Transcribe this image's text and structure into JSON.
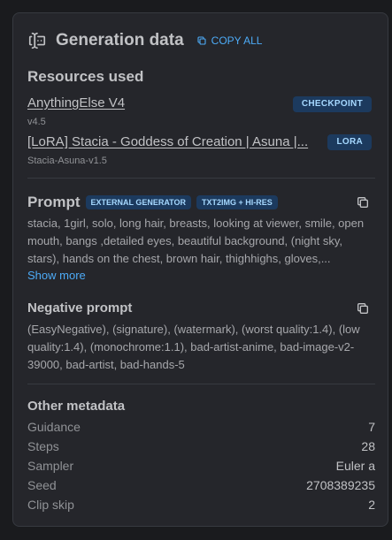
{
  "header": {
    "title": "Generation data",
    "copy_all_label": "COPY ALL"
  },
  "resources": {
    "title": "Resources used",
    "items": [
      {
        "name": "AnythingElse V4",
        "version": "v4.5",
        "type": "CHECKPOINT"
      },
      {
        "name": "[LoRA] Stacia - Goddess of Creation | Asuna |...",
        "version": "Stacia-Asuna-v1.5",
        "type": "LORA"
      }
    ]
  },
  "prompt": {
    "label": "Prompt",
    "badges": [
      "EXTERNAL GENERATOR",
      "TXT2IMG + HI-RES"
    ],
    "text": "stacia, 1girl, solo, long hair, breasts, looking at viewer, smile, open mouth, bangs ,detailed eyes, beautiful background, (night sky, stars), hands on the chest, brown hair, thighhighs, gloves,...",
    "show_more_label": "Show more"
  },
  "negative_prompt": {
    "label": "Negative prompt",
    "text": "(EasyNegative), (signature), (watermark), (worst quality:1.4), (low quality:1.4), (monochrome:1.1), bad-artist-anime, bad-image-v2-39000, bad-artist, bad-hands-5"
  },
  "metadata": {
    "title": "Other metadata",
    "rows": [
      {
        "key": "Guidance",
        "value": "7"
      },
      {
        "key": "Steps",
        "value": "28"
      },
      {
        "key": "Sampler",
        "value": "Euler a"
      },
      {
        "key": "Seed",
        "value": "2708389235"
      },
      {
        "key": "Clip skip",
        "value": "2"
      }
    ]
  },
  "colors": {
    "accent": "#4dabf7",
    "badge_bg": "#1c3a5e",
    "badge_text": "#a5d8ff",
    "card_bg": "#25262b"
  },
  "icons": {
    "header": "forms-icon",
    "copy_all": "copy-icon",
    "prompt_copy": "copy-icon",
    "negative_copy": "copy-icon"
  }
}
